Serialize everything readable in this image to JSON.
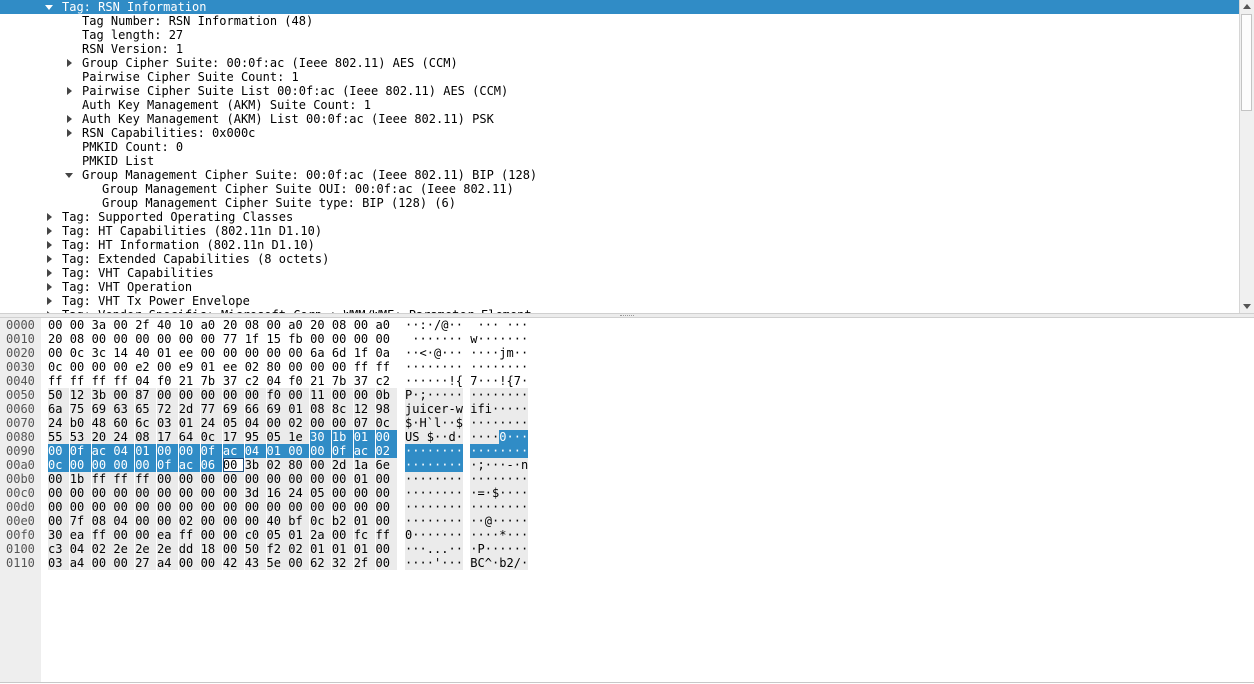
{
  "tree": {
    "rows": [
      {
        "label": "Tag: RSN Information",
        "level": 0,
        "toggle": "down",
        "selected": true
      },
      {
        "label": "Tag Number: RSN Information (48)",
        "level": 1,
        "toggle": "none"
      },
      {
        "label": "Tag length: 27",
        "level": 1,
        "toggle": "none"
      },
      {
        "label": "RSN Version: 1",
        "level": 1,
        "toggle": "none"
      },
      {
        "label": "Group Cipher Suite: 00:0f:ac (Ieee 802.11) AES (CCM)",
        "level": 1,
        "toggle": "right"
      },
      {
        "label": "Pairwise Cipher Suite Count: 1",
        "level": 1,
        "toggle": "none"
      },
      {
        "label": "Pairwise Cipher Suite List 00:0f:ac (Ieee 802.11) AES (CCM)",
        "level": 1,
        "toggle": "right"
      },
      {
        "label": "Auth Key Management (AKM) Suite Count: 1",
        "level": 1,
        "toggle": "none"
      },
      {
        "label": "Auth Key Management (AKM) List 00:0f:ac (Ieee 802.11) PSK",
        "level": 1,
        "toggle": "right"
      },
      {
        "label": "RSN Capabilities: 0x000c",
        "level": 1,
        "toggle": "right"
      },
      {
        "label": "PMKID Count: 0",
        "level": 1,
        "toggle": "none"
      },
      {
        "label": "PMKID List",
        "level": 1,
        "toggle": "none"
      },
      {
        "label": "Group Management Cipher Suite: 00:0f:ac (Ieee 802.11) BIP (128)",
        "level": 1,
        "toggle": "down"
      },
      {
        "label": "Group Management Cipher Suite OUI: 00:0f:ac (Ieee 802.11)",
        "level": 2,
        "toggle": "none"
      },
      {
        "label": "Group Management Cipher Suite type: BIP (128) (6)",
        "level": 2,
        "toggle": "none"
      },
      {
        "label": "Tag: Supported Operating Classes",
        "level": 0,
        "toggle": "right"
      },
      {
        "label": "Tag: HT Capabilities (802.11n D1.10)",
        "level": 0,
        "toggle": "right"
      },
      {
        "label": "Tag: HT Information (802.11n D1.10)",
        "level": 0,
        "toggle": "right"
      },
      {
        "label": "Tag: Extended Capabilities (8 octets)",
        "level": 0,
        "toggle": "right"
      },
      {
        "label": "Tag: VHT Capabilities",
        "level": 0,
        "toggle": "right"
      },
      {
        "label": "Tag: VHT Operation",
        "level": 0,
        "toggle": "right"
      },
      {
        "label": "Tag: VHT Tx Power Envelope",
        "level": 0,
        "toggle": "right"
      },
      {
        "label": "Tag: Vendor Specific: Microsoft Corp.: WMM/WME: Parameter Element",
        "level": 0,
        "toggle": "right"
      }
    ]
  },
  "bytes": {
    "lines": [
      {
        "offset": "0000",
        "hex": [
          "00",
          "00",
          "3a",
          "00",
          "2f",
          "40",
          "10",
          "a0",
          "20",
          "08",
          "00",
          "a0",
          "20",
          "08",
          "00",
          "a0"
        ],
        "ascii": "··:·/@··  ··· ···"
      },
      {
        "offset": "0010",
        "hex": [
          "20",
          "08",
          "00",
          "00",
          "00",
          "00",
          "00",
          "00",
          "77",
          "1f",
          "15",
          "fb",
          "00",
          "00",
          "00",
          "00"
        ],
        "ascii": " ······· w·······"
      },
      {
        "offset": "0020",
        "hex": [
          "00",
          "0c",
          "3c",
          "14",
          "40",
          "01",
          "ee",
          "00",
          "00",
          "00",
          "00",
          "00",
          "6a",
          "6d",
          "1f",
          "0a"
        ],
        "ascii": "··<·@··· ····jm··"
      },
      {
        "offset": "0030",
        "hex": [
          "0c",
          "00",
          "00",
          "00",
          "e2",
          "00",
          "e9",
          "01",
          "ee",
          "02",
          "80",
          "00",
          "00",
          "00",
          "ff",
          "ff"
        ],
        "ascii": "········ ········"
      },
      {
        "offset": "0040",
        "hex": [
          "ff",
          "ff",
          "ff",
          "ff",
          "04",
          "f0",
          "21",
          "7b",
          "37",
          "c2",
          "04",
          "f0",
          "21",
          "7b",
          "37",
          "c2"
        ],
        "ascii": "······!{ 7···!{7·"
      },
      {
        "offset": "0050",
        "hex": [
          "50",
          "12",
          "3b",
          "00",
          "87",
          "00",
          "00",
          "00",
          "00",
          "00",
          "f0",
          "00",
          "11",
          "00",
          "00",
          "0b"
        ],
        "ascii": "P·;····· ········"
      },
      {
        "offset": "0060",
        "hex": [
          "6a",
          "75",
          "69",
          "63",
          "65",
          "72",
          "2d",
          "77",
          "69",
          "66",
          "69",
          "01",
          "08",
          "8c",
          "12",
          "98"
        ],
        "ascii": "juicer-w ifi·····"
      },
      {
        "offset": "0070",
        "hex": [
          "24",
          "b0",
          "48",
          "60",
          "6c",
          "03",
          "01",
          "24",
          "05",
          "04",
          "00",
          "02",
          "00",
          "00",
          "07",
          "0c"
        ],
        "ascii": "$·H`l··$ ········"
      },
      {
        "offset": "0080",
        "hex": [
          "55",
          "53",
          "20",
          "24",
          "08",
          "17",
          "64",
          "0c",
          "17",
          "95",
          "05",
          "1e",
          "30",
          "1b",
          "01",
          "00"
        ],
        "ascii": "US $··d· ····0···"
      },
      {
        "offset": "0090",
        "hex": [
          "00",
          "0f",
          "ac",
          "04",
          "01",
          "00",
          "00",
          "0f",
          "ac",
          "04",
          "01",
          "00",
          "00",
          "0f",
          "ac",
          "02"
        ],
        "ascii": "········ ········"
      },
      {
        "offset": "00a0",
        "hex": [
          "0c",
          "00",
          "00",
          "00",
          "00",
          "0f",
          "ac",
          "06",
          "00",
          "3b",
          "02",
          "80",
          "00",
          "2d",
          "1a",
          "6e"
        ],
        "ascii": "········ ·;···-·n"
      },
      {
        "offset": "00b0",
        "hex": [
          "00",
          "1b",
          "ff",
          "ff",
          "ff",
          "00",
          "00",
          "00",
          "00",
          "00",
          "00",
          "00",
          "00",
          "00",
          "01",
          "00"
        ],
        "ascii": "········ ········"
      },
      {
        "offset": "00c0",
        "hex": [
          "00",
          "00",
          "00",
          "00",
          "00",
          "00",
          "00",
          "00",
          "00",
          "3d",
          "16",
          "24",
          "05",
          "00",
          "00",
          "00"
        ],
        "ascii": "········ ·=·$····"
      },
      {
        "offset": "00d0",
        "hex": [
          "00",
          "00",
          "00",
          "00",
          "00",
          "00",
          "00",
          "00",
          "00",
          "00",
          "00",
          "00",
          "00",
          "00",
          "00",
          "00"
        ],
        "ascii": "········ ········"
      },
      {
        "offset": "00e0",
        "hex": [
          "00",
          "7f",
          "08",
          "04",
          "00",
          "00",
          "02",
          "00",
          "00",
          "00",
          "40",
          "bf",
          "0c",
          "b2",
          "01",
          "00"
        ],
        "ascii": "········ ··@·····"
      },
      {
        "offset": "00f0",
        "hex": [
          "30",
          "ea",
          "ff",
          "00",
          "00",
          "ea",
          "ff",
          "00",
          "00",
          "c0",
          "05",
          "01",
          "2a",
          "00",
          "fc",
          "ff"
        ],
        "ascii": "0······· ····*···"
      },
      {
        "offset": "0100",
        "hex": [
          "c3",
          "04",
          "02",
          "2e",
          "2e",
          "2e",
          "dd",
          "18",
          "00",
          "50",
          "f2",
          "02",
          "01",
          "01",
          "01",
          "00"
        ],
        "ascii": "···...·· ·P······"
      },
      {
        "offset": "0110",
        "hex": [
          "03",
          "a4",
          "00",
          "00",
          "27",
          "a4",
          "00",
          "00",
          "42",
          "43",
          "5e",
          "00",
          "62",
          "32",
          "2f",
          "00"
        ],
        "ascii": "····'··· BC^·b2/·"
      }
    ],
    "selection": {
      "start": 140,
      "end": 168
    }
  }
}
